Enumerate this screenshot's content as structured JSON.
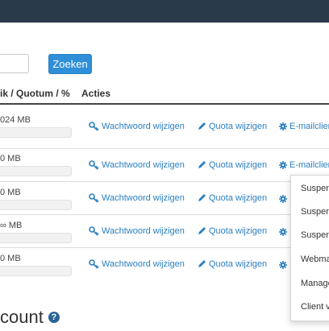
{
  "search": {
    "value": "",
    "button_label": "Zoeken"
  },
  "table": {
    "headers": {
      "usage": "ik / Quotum / %",
      "actions": "Acties"
    },
    "rows": [
      {
        "usage": "024 MB"
      },
      {
        "usage": "0 MB"
      },
      {
        "usage": "0 MB"
      },
      {
        "usage": "∞ MB"
      },
      {
        "usage": "0 MB"
      }
    ],
    "actions": {
      "password": "Wachtwoord wijzigen",
      "quota": "Quota wijzigen",
      "mailclient": "E-mailclient"
    }
  },
  "dropdown": {
    "items": [
      "Suspen",
      "Suspen",
      "Suspen",
      "Webma",
      "Manage",
      "Client v"
    ]
  },
  "section": {
    "title": "count"
  },
  "colors": {
    "topbar": "#293a4a",
    "primary": "#2f8fd8",
    "link": "#2a7fc0"
  }
}
